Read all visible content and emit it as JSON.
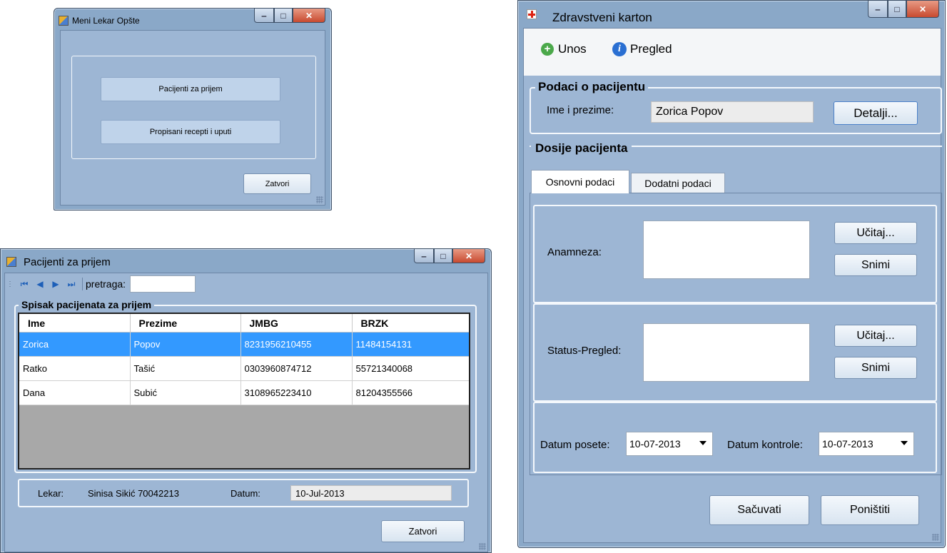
{
  "meni": {
    "title": "Meni Lekar Opšte",
    "btn_pacijenti": "Pacijenti za prijem",
    "btn_recepti": "Propisani recepti i uputi",
    "btn_zatvori": "Zatvori"
  },
  "prijem": {
    "title": "Pacijenti za prijem",
    "search_label": "pretraga:",
    "search_value": "",
    "group_title": "Spisak pacijenata za prijem",
    "columns": [
      "Ime",
      "Prezime",
      "JMBG",
      "BRZK"
    ],
    "rows": [
      [
        "Zorica",
        "Popov",
        "8231956210455",
        "11484154131"
      ],
      [
        "Ratko",
        "Tašić",
        "0303960874712",
        "55721340068"
      ],
      [
        "Dana",
        "Subić",
        "3108965223410",
        "81204355566"
      ]
    ],
    "lekar_label": "Lekar:",
    "lekar_value": "Sinisa Sikić 70042213",
    "datum_label": "Datum:",
    "datum_value": "10-Jul-2013",
    "btn_zatvori": "Zatvori"
  },
  "karton": {
    "title": "Zdravstveni karton",
    "menu_unos": "Unos",
    "menu_pregled": "Pregled",
    "podaci_title": "Podaci o pacijentu",
    "ime_label": "Ime i prezime:",
    "ime_value": "Zorica Popov",
    "btn_detalji": "Detalji...",
    "dosije_title": "Dosije pacijenta",
    "tab_osnovni": "Osnovni podaci",
    "tab_dodatni": "Dodatni podaci",
    "anamneza_label": "Anamneza:",
    "anamneza_value": "",
    "status_label": "Status-Pregled:",
    "status_value": "",
    "btn_ucitaj": "Učitaj...",
    "btn_snimi": "Snimi",
    "datum_posete_label": "Datum posete:",
    "datum_posete_value": "10-07-2013",
    "datum_kontrole_label": "Datum kontrole:",
    "datum_kontrole_value": "10-07-2013",
    "btn_sacuvati": "Sačuvati",
    "btn_ponistiti": "Poništiti"
  },
  "colors": {
    "window_frame": "#8aa8c8",
    "client_bg": "#9db6d4",
    "selected_row": "#3399ff",
    "close_button": "#c84a30"
  },
  "icons": {
    "app": "app-icon",
    "cross": "red-cross-icon",
    "unos": "green-plus-icon",
    "pregled": "blue-info-icon"
  }
}
